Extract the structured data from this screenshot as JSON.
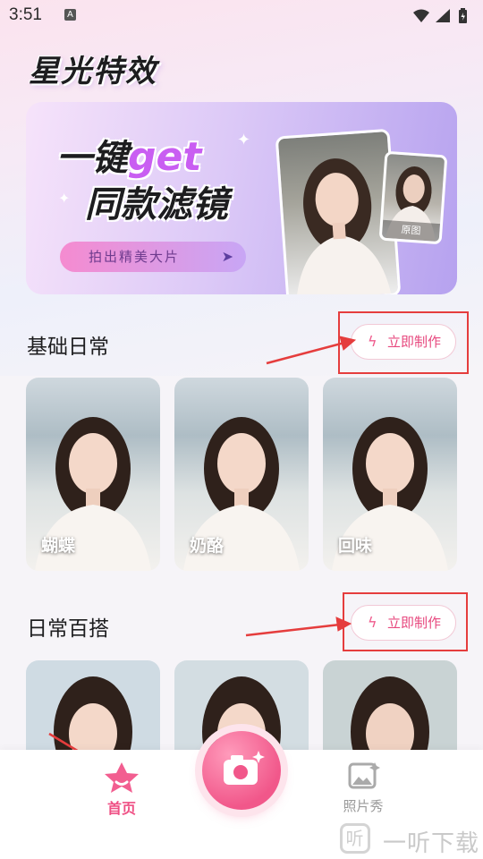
{
  "status_bar": {
    "time": "3:51",
    "a_badge": "A"
  },
  "app": {
    "title": "星光特效"
  },
  "banner": {
    "headline_part1": "一键",
    "headline_get": "get",
    "headline_line2": "同款滤镜",
    "button_label": "拍出精美大片",
    "original_label": "原图"
  },
  "sections": [
    {
      "title": "基础日常",
      "button_label": "立即制作",
      "cards": [
        {
          "label": "蝴蝶"
        },
        {
          "label": "奶酪"
        },
        {
          "label": "回味"
        }
      ]
    },
    {
      "title": "日常百搭",
      "button_label": "立即制作",
      "cards": [
        {
          "label": ""
        },
        {
          "label": ""
        },
        {
          "label": ""
        }
      ]
    }
  ],
  "tabbar": {
    "home": "首页",
    "photo_show": "照片秀"
  },
  "watermark": {
    "text": "一听下载",
    "icon_char": "听"
  },
  "colors": {
    "accent": "#ef4f84",
    "annotation_red": "#e53d3d"
  }
}
